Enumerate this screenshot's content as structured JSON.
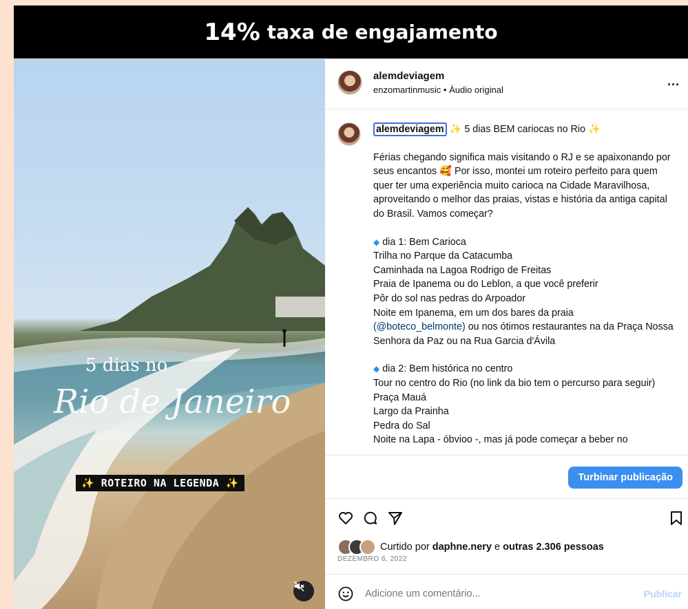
{
  "banner": {
    "percent": "14%",
    "text": "taxa de engajamento"
  },
  "photo": {
    "title_line1": "5 dias no",
    "title_line2": "Rio de Janeiro",
    "legend_pill": "ROTEIRO NA LEGENDA",
    "sparkle": "✨",
    "mute_icon": "muted-speaker-icon"
  },
  "post": {
    "username": "alemdeviagem",
    "audio_user": "enzomartinmusic",
    "audio_sep": "•",
    "audio_label": "Áudio original",
    "more": "...",
    "caption_title": "5 dias BEM cariocas no Rio",
    "caption_intro": "Férias chegando significa mais visitando o RJ e se apaixonando por seus encantos 🥰 Por isso, montei um roteiro perfeito para quem quer ter uma experiência muito carioca na Cidade Maravilhosa, aproveitando o melhor das praias, vistas e história da antiga capital do Brasil. Vamos começar?",
    "day1_title": "dia 1: Bem Carioca",
    "day1_lines": [
      "Trilha no Parque da Catacumba",
      "Caminhada na Lagoa Rodrigo de Freitas",
      "Praia de Ipanema ou do Leblon, a que você preferir",
      "Pôr do sol nas pedras do Arpoador",
      "Noite em Ipanema, em um dos bares da praia"
    ],
    "day1_link": "(@boteco_belmonte)",
    "day1_after_link": "ou nos ótimos restaurantes na da Praça Nossa Senhora da Paz ou na Rua Garcia d'Ávila",
    "day2_title": "dia 2: Bem histórica no centro",
    "day2_lines": [
      "Tour no centro do Rio (no link da bio tem o percurso para seguir)",
      "Praça Mauá",
      "Largo da Prainha",
      "Pedra do Sal",
      "Noite na Lapa - óbvioo -, mas já pode começar a beber no"
    ],
    "boost_label": "Turbinar publicação",
    "likes_prefix": "Curtido por",
    "likes_user": "daphne.nery",
    "likes_mid": "e",
    "likes_others": "outras 2.306 pessoas",
    "date": "DEZEMBRO 6, 2022",
    "comment_placeholder": "Adicione um comentário...",
    "publish_label": "Publicar"
  },
  "colors": {
    "accent": "#3a8ff0",
    "banner_bg": "#000000",
    "page_bg": "#fde2cf"
  }
}
